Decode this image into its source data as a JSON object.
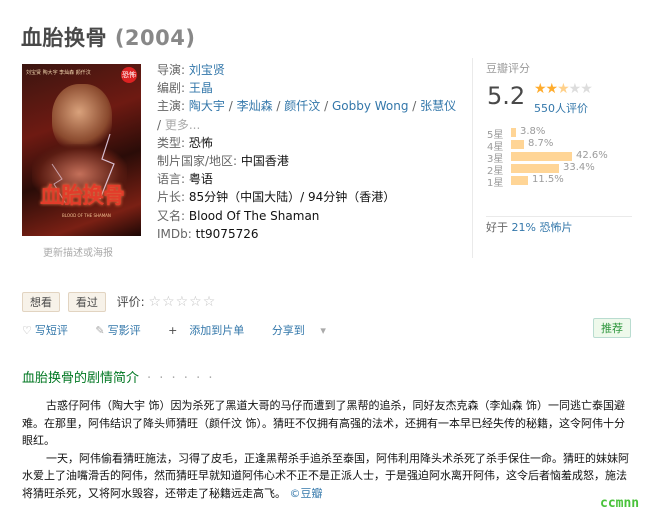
{
  "title": {
    "name": "血胎换骨",
    "year": "(2004)"
  },
  "poster": {
    "cast_text": "刘宝贤 陶大宇\n李灿森 颜仟汶",
    "stamp": "恐怖",
    "title_art": "血胎换骨",
    "sub": "BLOOD OF THE SHAMAN",
    "more_link": "更新描述或海报"
  },
  "info": {
    "director_label": "导演:",
    "director": "刘宝贤",
    "writer_label": "编剧:",
    "writer": "王晶",
    "cast_label": "主演:",
    "cast": [
      "陶大宇",
      "李灿森",
      "颜仟汶",
      "Gobby Wong",
      "张慧仪"
    ],
    "cast_more": "更多...",
    "genre_label": "类型:",
    "genre": "恐怖",
    "country_label": "制片国家/地区:",
    "country": "中国香港",
    "language_label": "语言:",
    "language": "粤语",
    "runtime_label": "片长:",
    "runtime": "85分钟（中国大陆）/ 94分钟（香港）",
    "aka_label": "又名:",
    "aka": "Blood Of The Shaman",
    "imdb_label": "IMDb:",
    "imdb": "tt9075726"
  },
  "rating": {
    "label": "豆瓣评分",
    "score": "5.2",
    "stars_value": 2.5,
    "count": "550人评价",
    "distribution": [
      {
        "label": "5星",
        "pct": "3.8%",
        "value": 3.8
      },
      {
        "label": "4星",
        "pct": "8.7%",
        "value": 8.7
      },
      {
        "label": "3星",
        "pct": "42.6%",
        "value": 42.6
      },
      {
        "label": "2星",
        "pct": "33.4%",
        "value": 33.4
      },
      {
        "label": "1星",
        "pct": "11.5%",
        "value": 11.5
      }
    ],
    "better_than_prefix": "好于",
    "better_than_pct": "21%",
    "better_than_genre": "恐怖片"
  },
  "actions": {
    "want": "想看",
    "seen": "看过",
    "rate_label": "评价:",
    "stars": "☆☆☆☆☆"
  },
  "links": {
    "short_review": "写短评",
    "review": "写影评",
    "add_list": "添加到片单",
    "share": "分享到"
  },
  "recommend": "推荐",
  "intro": {
    "title": "血胎换骨的剧情简介",
    "dots": "· · · · · ·",
    "paragraph1": "古惑仔阿伟（陶大宇 饰）因为杀死了黑道大哥的马仔而遭到了黑帮的追杀，同好友杰克森（李灿森 饰）一同逃亡泰国避难。在那里，阿伟结识了降头师猜旺（颜仟汶 饰）。猜旺不仅拥有高强的法术，还拥有一本早已经失传的秘籍，这令阿伟十分眼红。",
    "paragraph2": "一天，阿伟偷看猜旺施法，习得了皮毛，正逢黑帮杀手追杀至泰国，阿伟利用降头术杀死了杀手保住一命。猜旺的妹妹阿水爱上了油嘴滑舌的阿伟，然而猜旺早就知道阿伟心术不正不是正派人士，于是强迫阿水离开阿伟，这令后者恼羞成怒，施法将猜旺杀死，又将阿水毁容，还带走了秘籍远走高飞。",
    "source": "©豆瓣"
  },
  "watermark": "ccmnn",
  "colors": {
    "link": "#3377aa",
    "intro_title": "#007722",
    "star_on": "#ffac2d",
    "bar": "#ffd596",
    "recommend": "#2e963d"
  }
}
